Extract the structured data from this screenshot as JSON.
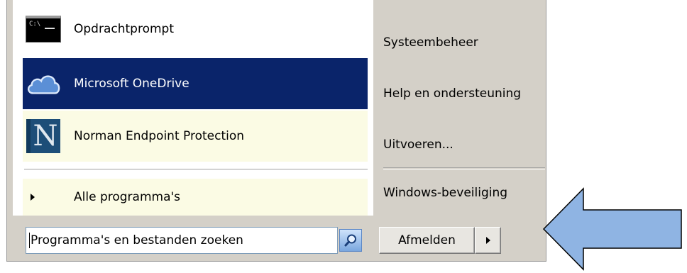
{
  "start_menu": {
    "pinned_items": [
      {
        "label": "Opdrachtprompt",
        "icon": "cmd-icon"
      },
      {
        "label": "Microsoft OneDrive",
        "icon": "onedrive-icon",
        "selected": true
      },
      {
        "label": "Norman Endpoint Protection",
        "icon": "norman-icon"
      }
    ],
    "all_programs_label": "Alle programma's",
    "search": {
      "placeholder": "Programma's en bestanden zoeken",
      "value": ""
    },
    "right_items": [
      "Systeembeheer",
      "Help en ondersteuning",
      "Uitvoeren...",
      "Windows-beveiliging"
    ],
    "logoff_label": "Afmelden",
    "more_options_icon": "triangle-right-icon"
  },
  "colors": {
    "selected_bg": "#0a246a",
    "highlight_bg": "#fbfbe4",
    "menu_bg": "#d4d0c8",
    "arrow_fill": "#8fb4e3",
    "arrow_stroke": "#000000"
  },
  "annotation": {
    "icon": "left-pointing-arrow-icon"
  }
}
